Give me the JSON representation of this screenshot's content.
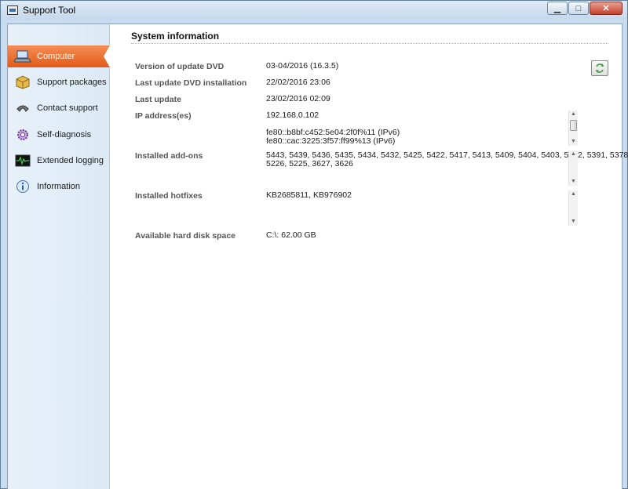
{
  "window": {
    "title": "Support Tool",
    "controls": {
      "minimize": "▁",
      "maximize": "□",
      "close": "✕"
    }
  },
  "sidebar": {
    "items": [
      {
        "label": "Computer",
        "icon": "laptop-icon",
        "active": true
      },
      {
        "label": "Support packages",
        "icon": "package-icon",
        "active": false
      },
      {
        "label": "Contact support",
        "icon": "phone-icon",
        "active": false
      },
      {
        "label": "Self-diagnosis",
        "icon": "gear-icon",
        "active": false
      },
      {
        "label": "Extended logging",
        "icon": "waveform-icon",
        "active": false
      },
      {
        "label": "Information",
        "icon": "info-icon",
        "active": false
      }
    ]
  },
  "main": {
    "section_title": "System information",
    "rows": [
      {
        "label": "Version of update DVD",
        "value": [
          "03-04/2016 (16.3.5)"
        ]
      },
      {
        "label": "Last update DVD installation",
        "value": [
          "22/02/2016 23:06"
        ]
      },
      {
        "label": "Last update",
        "value": [
          "23/02/2016 02:09"
        ]
      },
      {
        "label": "IP address(es)",
        "value": [
          "192.168.0.102",
          "",
          "fe80::b8bf:c452:5e04:2f0f%11 (IPv6)",
          "fe80::cac:3225:3f57:ff99%13 (IPv6)"
        ]
      },
      {
        "label": "Installed add-ons",
        "value": [
          "5443, 5439, 5436, 5435, 5434, 5432, 5425, 5422, 5417, 5413, 5409, 5404, 5403, 5402, 5391, 5378,",
          "5226, 5225, 3627, 3626"
        ]
      },
      {
        "label": "Installed hotfixes",
        "value": [
          "KB2685811, KB976902"
        ]
      },
      {
        "label": "Available hard disk space",
        "value": [
          "C:\\: 62.00 GB"
        ]
      }
    ]
  },
  "colors": {
    "active_nav": "#e8692b",
    "sidebar_bg": "#e3eef8",
    "refresh_icon": "#3aa040"
  }
}
